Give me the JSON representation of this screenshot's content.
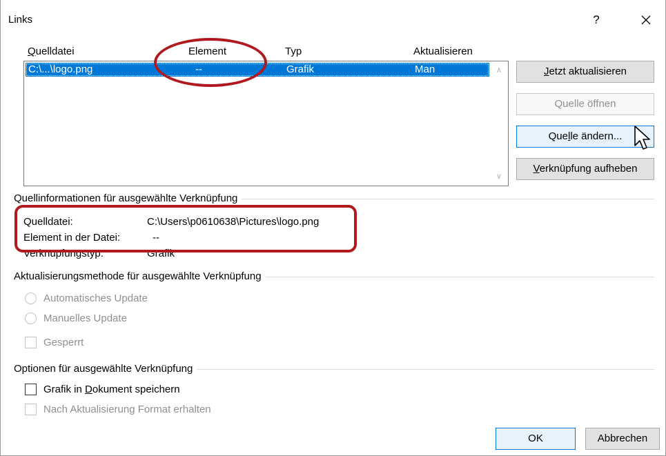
{
  "window": {
    "title": "Links",
    "help_glyph": "?",
    "close_glyph": "✕"
  },
  "list": {
    "columns": {
      "source_pre": "",
      "source_mn": "Q",
      "source_post": "uelldatei",
      "element": "Element",
      "type": "Typ",
      "update": "Aktualisieren"
    },
    "rows": [
      {
        "source": "C:\\...\\logo.png",
        "element": "--",
        "type": "Grafik",
        "update": "Man"
      }
    ],
    "scroll_up": "∧",
    "scroll_down": "∨"
  },
  "buttons": {
    "update_now_mn": "J",
    "update_now_rest": "etzt aktualisieren",
    "open_source": "Quelle öffnen",
    "change_source_pre": "Que",
    "change_source_mn": "l",
    "change_source_post": "le ändern...",
    "break_link_mn": "V",
    "break_link_rest": "erknüpfung aufheben",
    "ok": "OK",
    "cancel": "Abbrechen"
  },
  "source_info": {
    "heading": "Quellinformationen für ausgewählte Verknüpfung",
    "file_label": "Quelldatei:",
    "file_value": "C:\\Users\\p0610638\\Pictures\\logo.png",
    "element_label": "Element in der Datei:",
    "element_value": "--",
    "link_type_label": "Verknüpfungstyp:",
    "link_type_value": "Grafik"
  },
  "update_method": {
    "heading": "Aktualisierungsmethode für ausgewählte Verknüpfung",
    "auto": "Automatisches Update",
    "manual": "Manuelles Update",
    "locked": "Gesperrt"
  },
  "options": {
    "heading": "Optionen für ausgewählte Verknüpfung",
    "save_pre": "Grafik in ",
    "save_mn": "D",
    "save_post": "okument speichern",
    "keep_format": "Nach Aktualisierung Format erhalten"
  },
  "colors": {
    "selection": "#0078d7",
    "annotation": "#b01a1f"
  }
}
